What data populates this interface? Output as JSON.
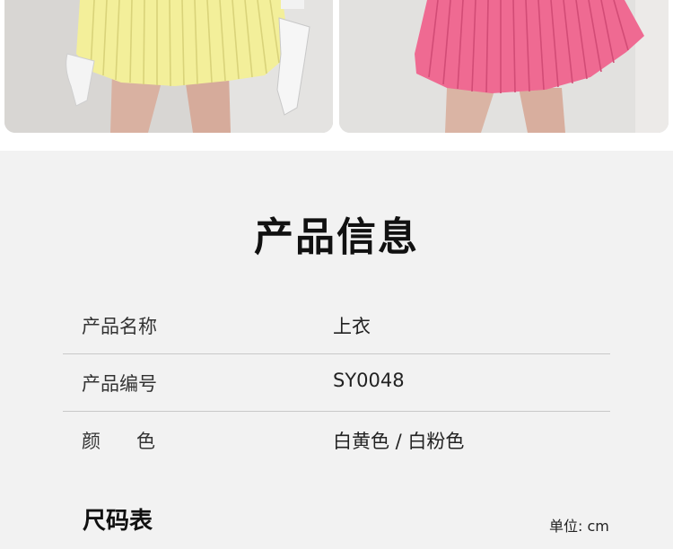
{
  "photos": {
    "left": {
      "skirt_color": "#f3ef9a",
      "description_icon": "yellow-pleated-skirt-photo"
    },
    "right": {
      "skirt_color": "#ef6a92",
      "description_icon": "pink-pleated-skirt-photo"
    }
  },
  "section_title": "产品信息",
  "product_info": [
    {
      "label": "产品名称",
      "value": "上衣"
    },
    {
      "label": "产品编号",
      "value": "SY0048"
    },
    {
      "label": "颜      色",
      "value": "白黄色 / 白粉色"
    }
  ],
  "size_chart": {
    "title": "尺码表",
    "unit": "单位: cm"
  }
}
